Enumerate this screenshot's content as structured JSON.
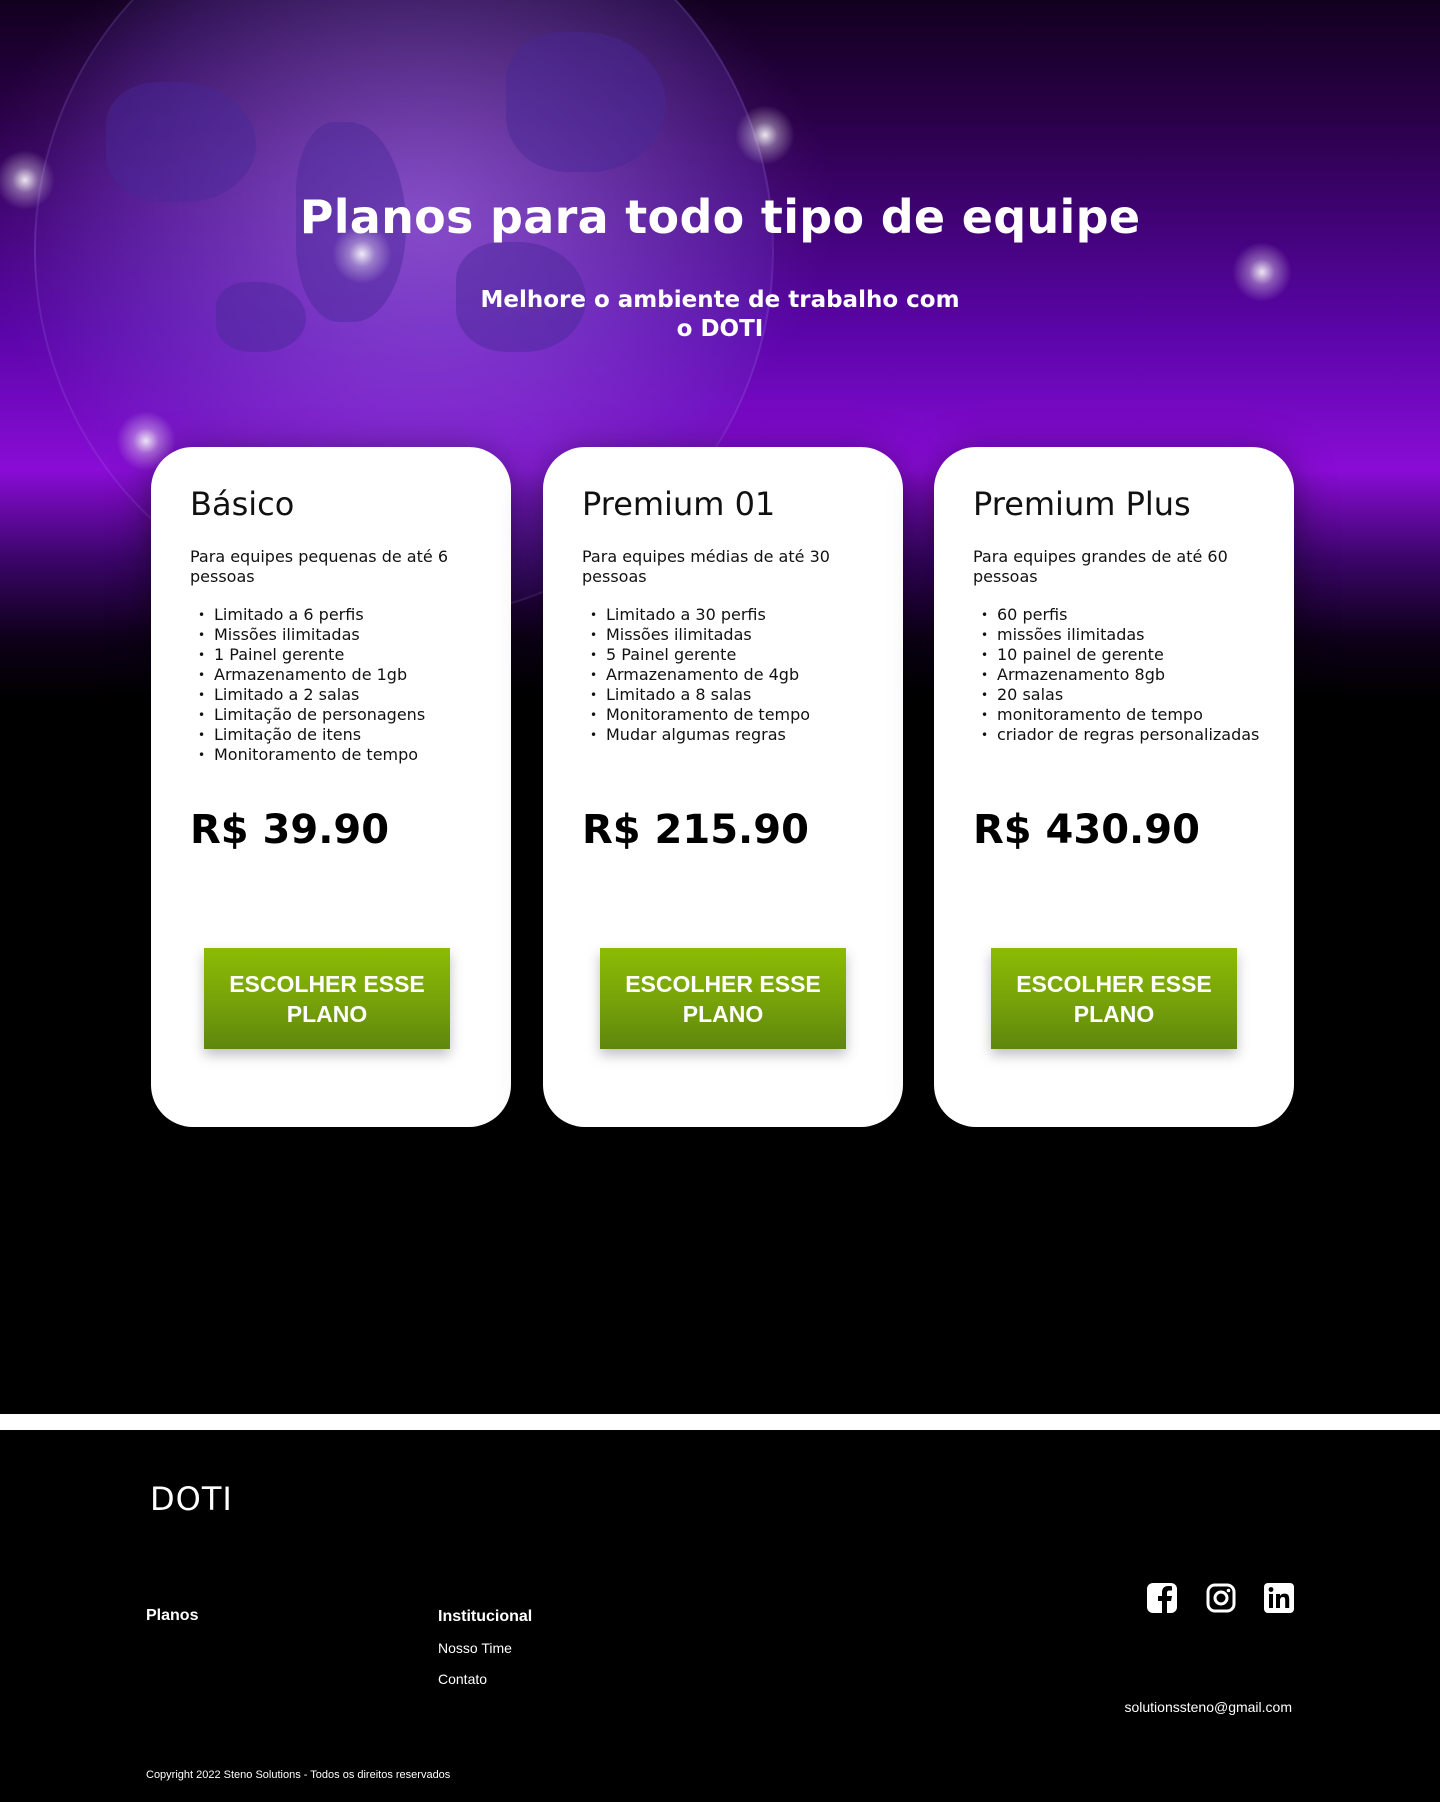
{
  "hero": {
    "title": "Planos para todo tipo de equipe",
    "subtitle": "Melhore o ambiente de trabalho com o DOTI"
  },
  "plans": [
    {
      "name": "Básico",
      "description": "Para equipes pequenas de até 6 pessoas",
      "features": [
        "Limitado a 6 perfis",
        "Missões ilimitadas",
        "1 Painel gerente",
        "Armazenamento de 1gb",
        "Limitado a 2 salas",
        "Limitação de personagens",
        "Limitação de itens",
        "Monitoramento de tempo"
      ],
      "price": "R$ 39.90",
      "button_label": "ESCOLHER ESSE PLANO"
    },
    {
      "name": "Premium 01",
      "description": "Para equipes médias de até 30 pessoas",
      "features": [
        "Limitado a 30 perfis",
        "Missões ilimitadas",
        "5 Painel gerente",
        "Armazenamento de 4gb",
        "Limitado a 8 salas",
        "Monitoramento de tempo",
        "Mudar algumas regras"
      ],
      "price": "R$ 215.90",
      "button_label": "ESCOLHER ESSE PLANO"
    },
    {
      "name": "Premium Plus",
      "description": "Para equipes grandes de até 60 pessoas",
      "features": [
        "60 perfis",
        "missões ilimitadas",
        "10 painel de gerente",
        "Armazenamento 8gb",
        "20 salas",
        "monitoramento de tempo",
        "criador de regras personalizadas"
      ],
      "price": "R$ 430.90",
      "button_label": "ESCOLHER ESSE PLANO"
    }
  ],
  "footer": {
    "logo_text": "DOTI",
    "planos_heading": "Planos",
    "institucional_heading": "Institucional",
    "links": [
      "Nosso Time",
      "Contato"
    ],
    "social_icons": [
      "facebook-icon",
      "instagram-icon",
      "linkedin-icon"
    ],
    "email": "solutionssteno@gmail.com",
    "copyright": "Copyright 2022 Steno Solutions - Todos os direitos reservados"
  },
  "colors": {
    "accent_button": "#7aa80a",
    "hero_purple": "#8a0cd6",
    "background": "#000000",
    "card": "#ffffff"
  }
}
